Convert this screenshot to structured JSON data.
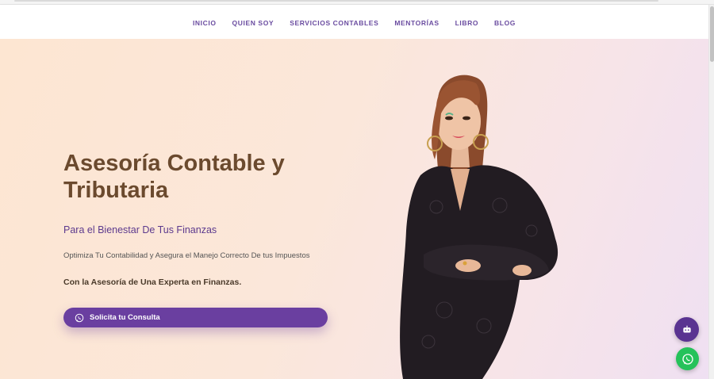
{
  "nav": {
    "items": [
      {
        "label": "INICIO"
      },
      {
        "label": "QUIEN SOY"
      },
      {
        "label": "SERVICIOS CONTABLES"
      },
      {
        "label": "MENTORÍAS"
      },
      {
        "label": "LIBRO"
      },
      {
        "label": "BLOG"
      }
    ]
  },
  "hero": {
    "title": "Asesoría Contable y\n Tributaria",
    "subtitle": "Para el Bienestar De Tus Finanzas",
    "description": "Optimiza Tu Contabilidad y Asegura el Manejo Correcto De tus Impuestos",
    "expert_line": "Con la Asesoría de Una Experta en Finanzas.",
    "cta_label": "Solicita tu Consulta",
    "cta_icon": "whatsapp-icon"
  },
  "floating": {
    "chat_icon": "chatbot-icon",
    "whatsapp_icon": "whatsapp-icon"
  },
  "colors": {
    "brand_purple": "#6a3fa0",
    "title_brown": "#6b4a2e",
    "whatsapp_green": "#25c25a"
  }
}
